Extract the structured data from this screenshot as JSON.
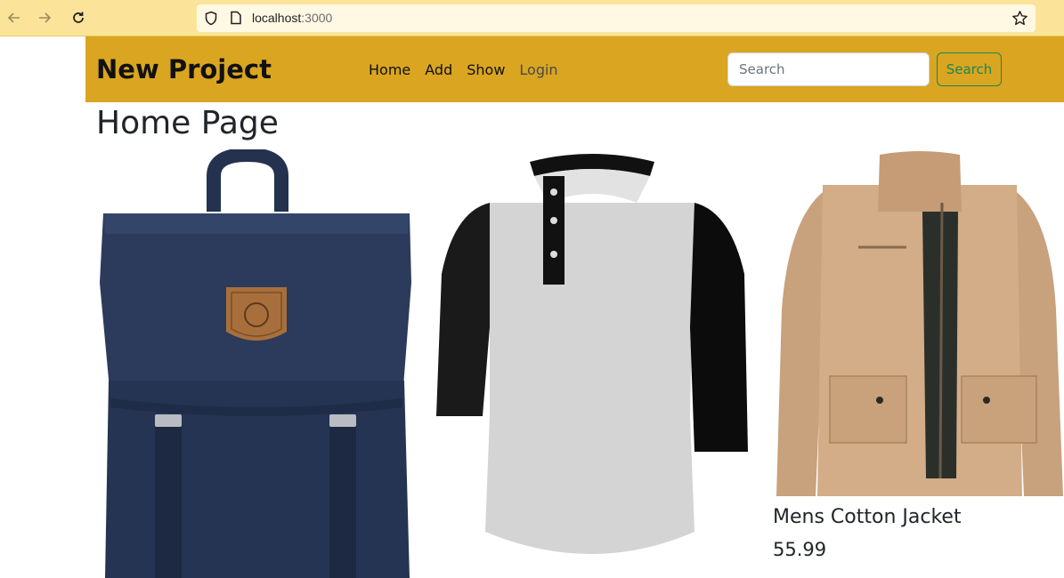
{
  "browser": {
    "url_host": "localhost",
    "url_port": ":3000"
  },
  "navbar": {
    "brand": "New Project",
    "links": [
      {
        "label": "Home"
      },
      {
        "label": "Add"
      },
      {
        "label": "Show"
      },
      {
        "label": "Login"
      }
    ],
    "search_placeholder": "Search",
    "search_button": "Search",
    "background_color": "#daa520",
    "button_color": "#198754"
  },
  "page": {
    "title": "Home Page"
  },
  "products": [
    {
      "image": "navy-backpack"
    },
    {
      "image": "raglan-henley-shirt"
    },
    {
      "image": "khaki-cotton-jacket",
      "name": "Mens Cotton Jacket",
      "price": "55.99"
    }
  ]
}
